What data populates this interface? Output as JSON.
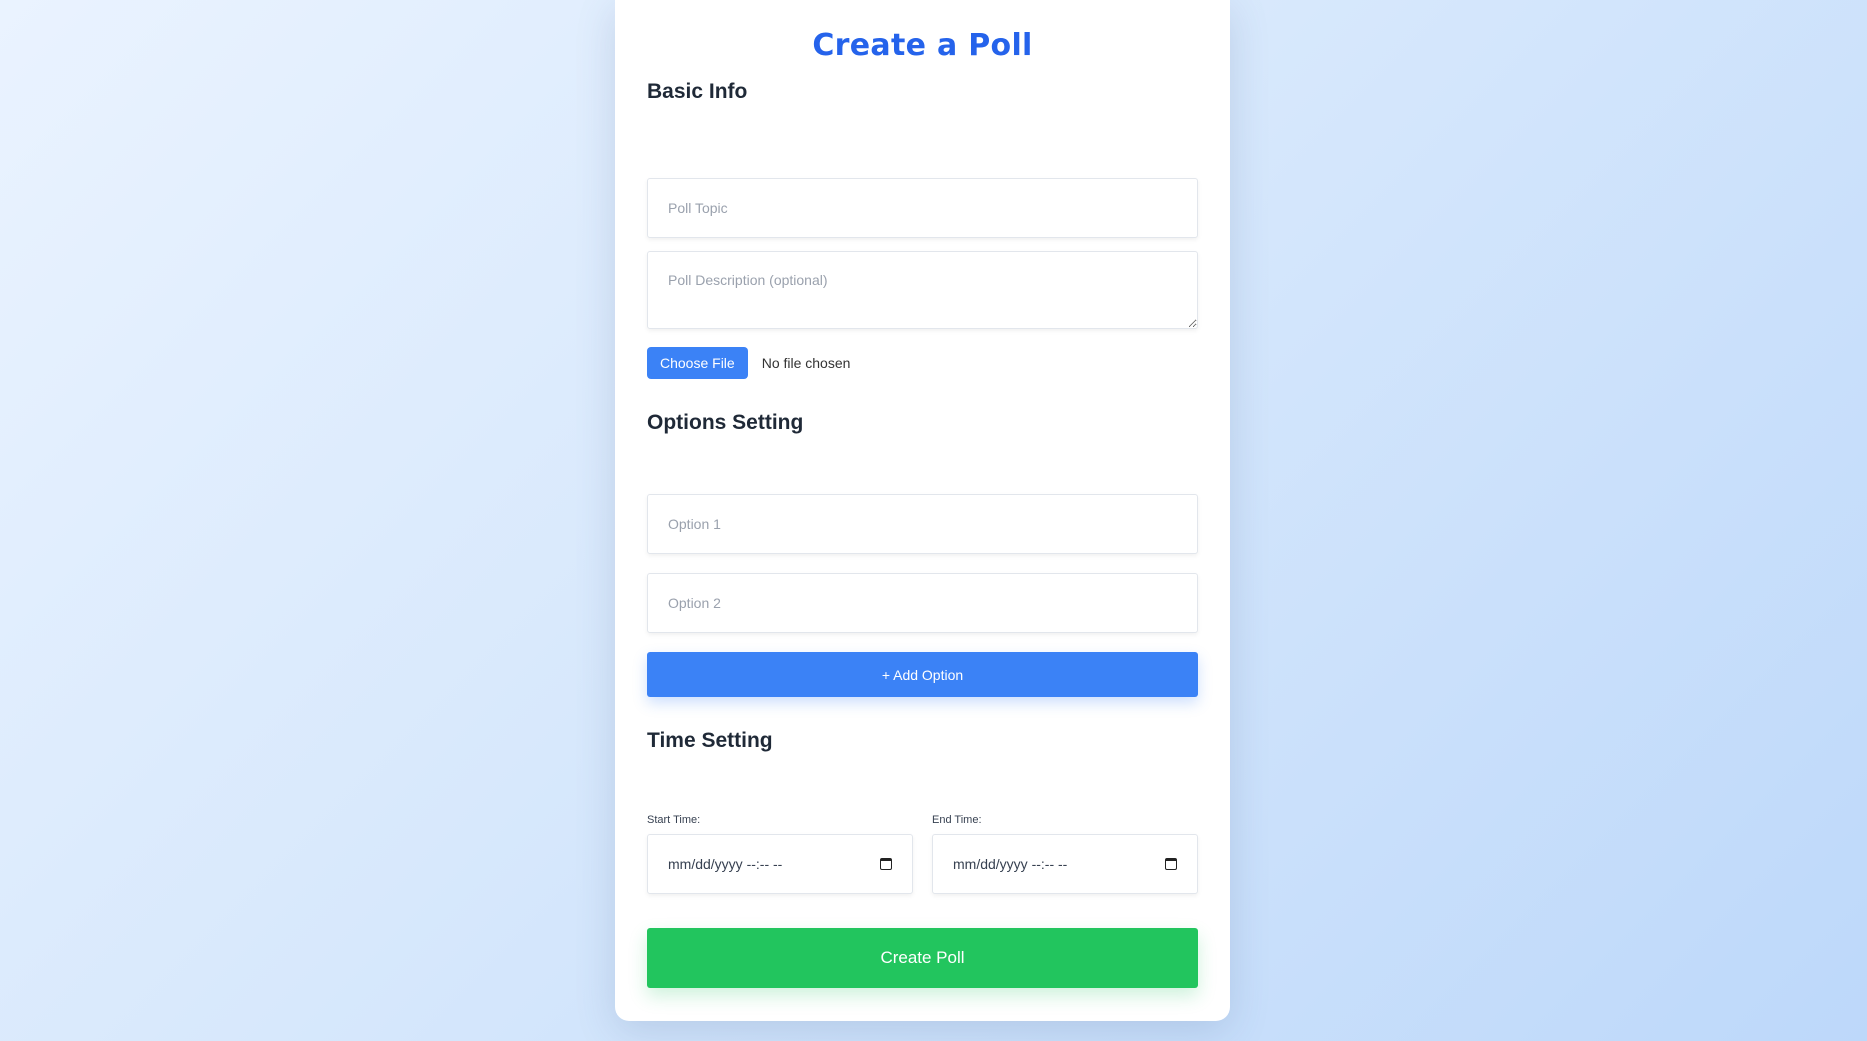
{
  "title": "Create a Poll",
  "basic_info": {
    "heading": "Basic Info",
    "topic_placeholder": "Poll Topic",
    "description_placeholder": "Poll Description (optional)",
    "choose_file_label": "Choose File",
    "file_status": "No file chosen"
  },
  "options": {
    "heading": "Options Setting",
    "items": [
      {
        "placeholder": "Option 1"
      },
      {
        "placeholder": "Option 2"
      }
    ],
    "add_label": "+ Add Option"
  },
  "time": {
    "heading": "Time Setting",
    "start_label": "Start Time:",
    "end_label": "End Time:",
    "start_value": "mm/dd/yyyy --:-- --",
    "end_value": "mm/dd/yyyy --:-- --"
  },
  "submit_label": "Create Poll",
  "colors": {
    "accent": "#2563eb",
    "button_blue": "#3b82f6",
    "submit_green": "#22c55e"
  }
}
